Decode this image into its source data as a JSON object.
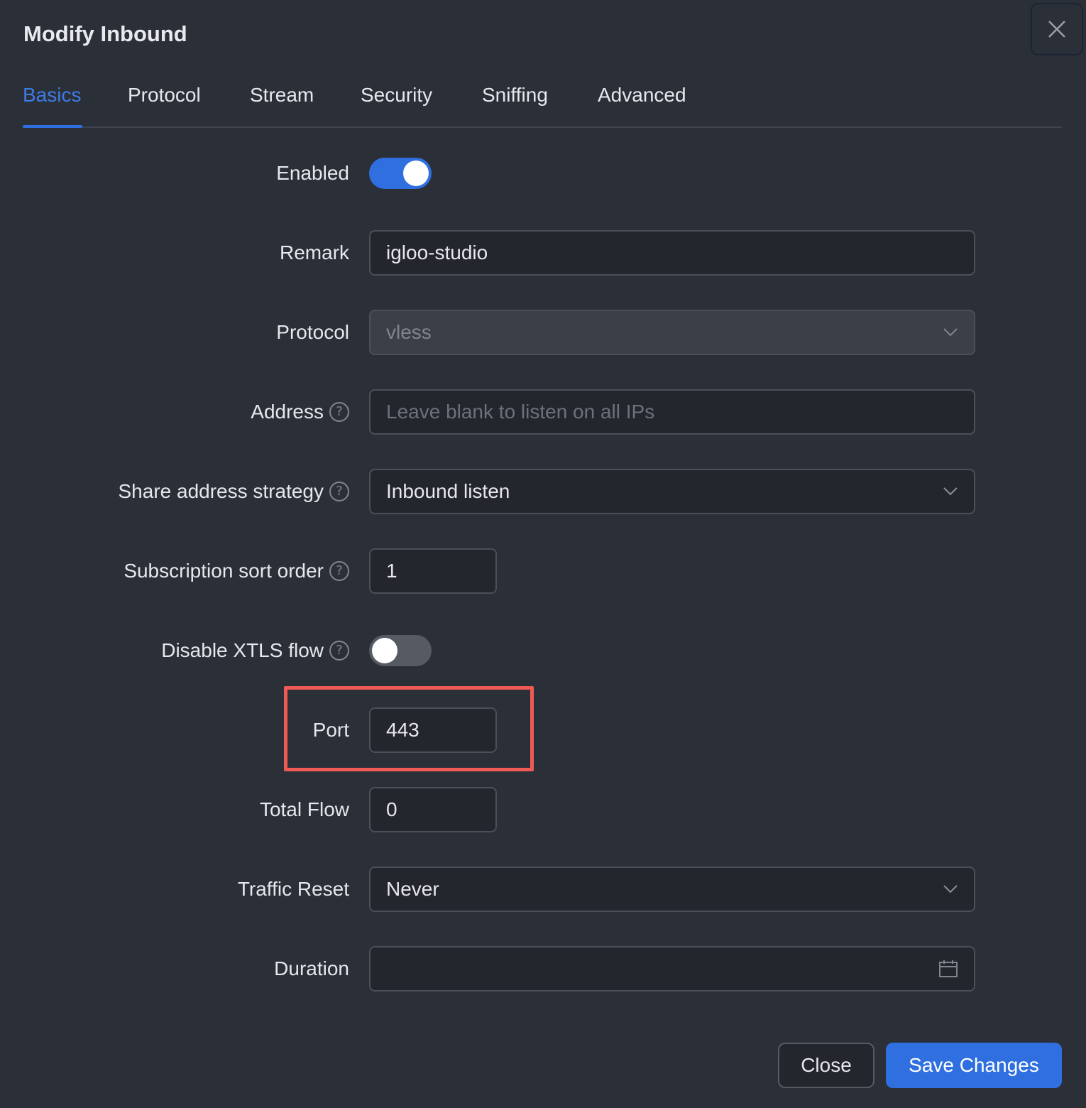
{
  "dialog": {
    "title": "Modify Inbound",
    "close_icon": "close-icon"
  },
  "tabs": [
    {
      "label": "Basics",
      "active": true
    },
    {
      "label": "Protocol",
      "active": false
    },
    {
      "label": "Stream",
      "active": false
    },
    {
      "label": "Security",
      "active": false
    },
    {
      "label": "Sniffing",
      "active": false
    },
    {
      "label": "Advanced",
      "active": false
    }
  ],
  "form": {
    "enabled": {
      "label": "Enabled",
      "value": true
    },
    "remark": {
      "label": "Remark",
      "value": "igloo-studio"
    },
    "protocol": {
      "label": "Protocol",
      "value": "vless",
      "disabled": true
    },
    "address": {
      "label": "Address",
      "value": "",
      "placeholder": "Leave blank to listen on all IPs"
    },
    "share_address_strategy": {
      "label": "Share address strategy",
      "value": "Inbound listen"
    },
    "subscription_sort_order": {
      "label": "Subscription sort order",
      "value": "1"
    },
    "disable_xtls_flow": {
      "label": "Disable XTLS flow",
      "value": false
    },
    "port": {
      "label": "Port",
      "value": "443",
      "highlighted": true
    },
    "total_flow": {
      "label": "Total Flow",
      "value": "0"
    },
    "traffic_reset": {
      "label": "Traffic Reset",
      "value": "Never"
    },
    "duration": {
      "label": "Duration",
      "value": ""
    }
  },
  "footer": {
    "close_label": "Close",
    "save_label": "Save Changes"
  },
  "colors": {
    "accent": "#2f6fe0",
    "highlight": "#f05a55",
    "background": "#2b2f38"
  }
}
